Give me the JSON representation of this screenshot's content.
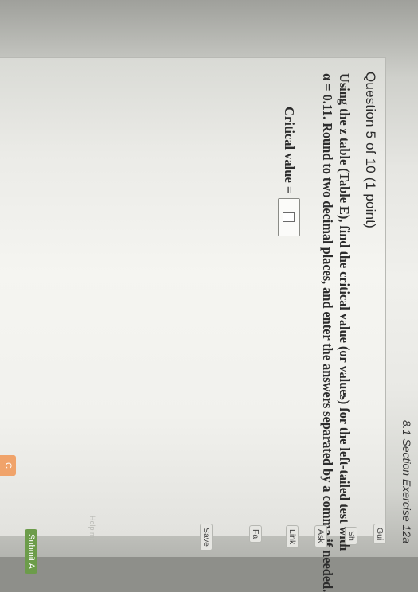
{
  "question": {
    "heading": "Question 5 of 10 (1 point)",
    "section": "8.1 Section Exercise 12a",
    "lines": [
      "Using the z table (Table E), find the critical value (or values) for the left-tailed test with",
      "α = 0.11. Round to two decimal places, and enter the answers separated by a comma if needed."
    ],
    "answer_label": "Critical value ="
  },
  "answer": {
    "value": ""
  },
  "accent_tab_label": "C",
  "sidebar": {
    "buttons": {
      "guided": "Gui",
      "show": "Sh",
      "ask": "Ask",
      "link": "Link",
      "fa": "Fa",
      "save": "Save",
      "submit": "Submit A"
    },
    "faint_button": "Help me"
  },
  "colors": {
    "submit": "#6c9c4a",
    "accent_tab": "#f0a36a"
  }
}
